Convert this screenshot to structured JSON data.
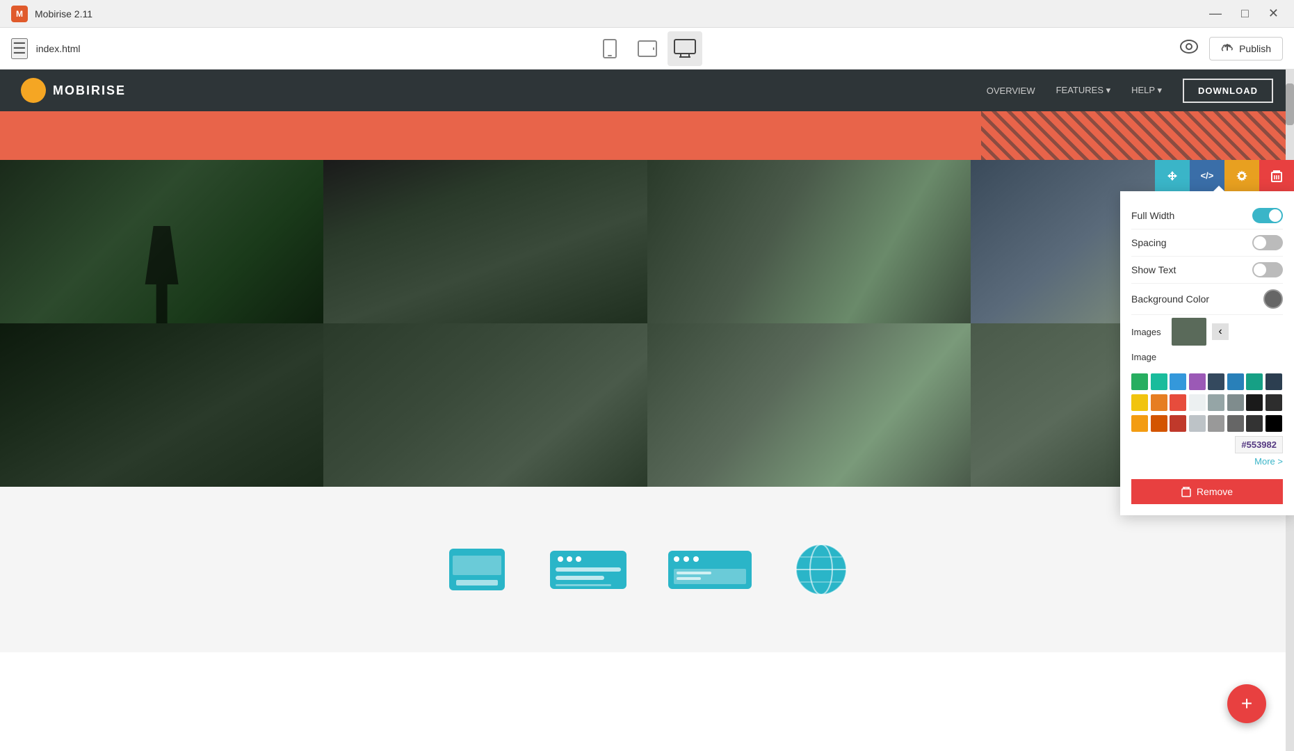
{
  "app": {
    "title": "Mobirise 2.11",
    "logo_letter": "M",
    "filename": "index.html"
  },
  "window_controls": {
    "minimize": "—",
    "maximize": "□",
    "close": "✕"
  },
  "toolbar": {
    "menu_icon": "☰",
    "device_mobile": "📱",
    "device_tablet": "⬜",
    "device_desktop": "🖥",
    "preview_icon": "👁",
    "publish_icon": "☁",
    "publish_label": "Publish"
  },
  "nav": {
    "logo_text": "MOBIRISE",
    "links": [
      "OVERVIEW",
      "FEATURES ▾",
      "HELP ▾"
    ],
    "download_label": "DOWNLOAD"
  },
  "section_toolbar": {
    "move_icon": "⇅",
    "code_icon": "</>",
    "settings_icon": "⚙",
    "delete_icon": "🗑"
  },
  "settings_panel": {
    "full_width_label": "Full Width",
    "full_width_on": true,
    "spacing_label": "Spacing",
    "spacing_on": false,
    "show_text_label": "Show Text",
    "show_text_on": false,
    "background_color_label": "Background Color",
    "images_label": "Images",
    "image_label": "Image",
    "color_hex": "#553982",
    "more_label": "More >",
    "remove_label": "Remove",
    "colors_row1": [
      "#27ae60",
      "#1abc9c",
      "#3498db",
      "#9b59b6",
      "#34495e",
      "#2980b9",
      "#16a085",
      "#2c3e50"
    ],
    "colors_row2": [
      "#f1c40f",
      "#e67e22",
      "#e74c3c",
      "#ecf0f1",
      "#95a5a6",
      "#7f8c8d",
      "#1a1a1a",
      "#2d2d2d"
    ],
    "colors_row3": [
      "#f39c12",
      "#d35400",
      "#c0392b",
      "#bdc3c7",
      "#999",
      "#666",
      "#333",
      "#000"
    ]
  },
  "fab": {
    "icon": "+"
  },
  "bottom_icons": [
    {
      "type": "tablet-icon"
    },
    {
      "type": "menu-icon"
    },
    {
      "type": "window-icon"
    },
    {
      "type": "globe-icon"
    }
  ]
}
